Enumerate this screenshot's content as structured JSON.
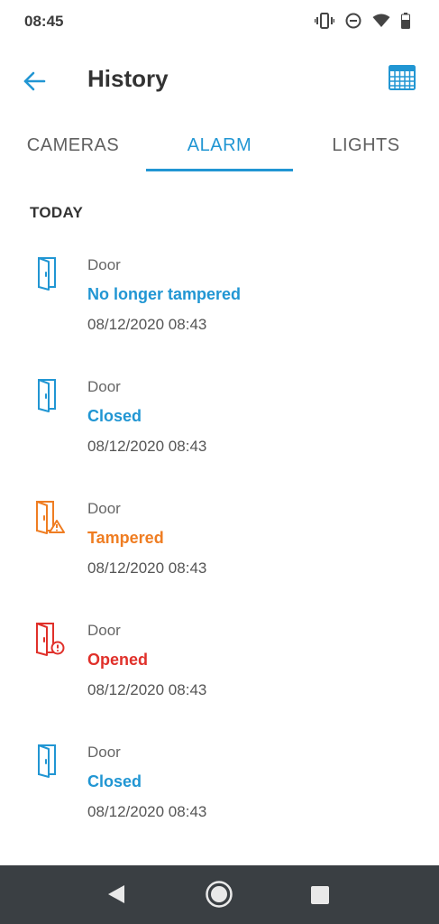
{
  "status_bar": {
    "time": "08:45",
    "icons": [
      "vibrate-icon",
      "do-not-disturb-icon",
      "wifi-icon",
      "battery-icon"
    ]
  },
  "header": {
    "title": "History",
    "back_icon": "arrow-left-icon",
    "calendar_icon": "calendar-icon"
  },
  "tabs": [
    {
      "label": "CAMERAS",
      "selected": false
    },
    {
      "label": "ALARM",
      "selected": true
    },
    {
      "label": "LIGHTS",
      "selected": false
    }
  ],
  "section": {
    "title": "TODAY"
  },
  "events": [
    {
      "device": "Door",
      "status": "No longer tampered",
      "time": "08/12/2020 08:43",
      "icon": "door-icon",
      "color": "#2196d3"
    },
    {
      "device": "Door",
      "status": "Closed",
      "time": "08/12/2020 08:43",
      "icon": "door-icon",
      "color": "#2196d3"
    },
    {
      "device": "Door",
      "status": "Tampered",
      "time": "08/12/2020 08:43",
      "icon": "door-warning-icon",
      "color": "#ef7d22"
    },
    {
      "device": "Door",
      "status": "Opened",
      "time": "08/12/2020 08:43",
      "icon": "door-alert-icon",
      "color": "#e0302a"
    },
    {
      "device": "Door",
      "status": "Closed",
      "time": "08/12/2020 08:43",
      "icon": "door-icon",
      "color": "#2196d3"
    }
  ],
  "colors": {
    "accent": "#2196d3",
    "warning": "#ef7d22",
    "alert": "#e0302a",
    "nav_bar": "#3a3f43"
  }
}
